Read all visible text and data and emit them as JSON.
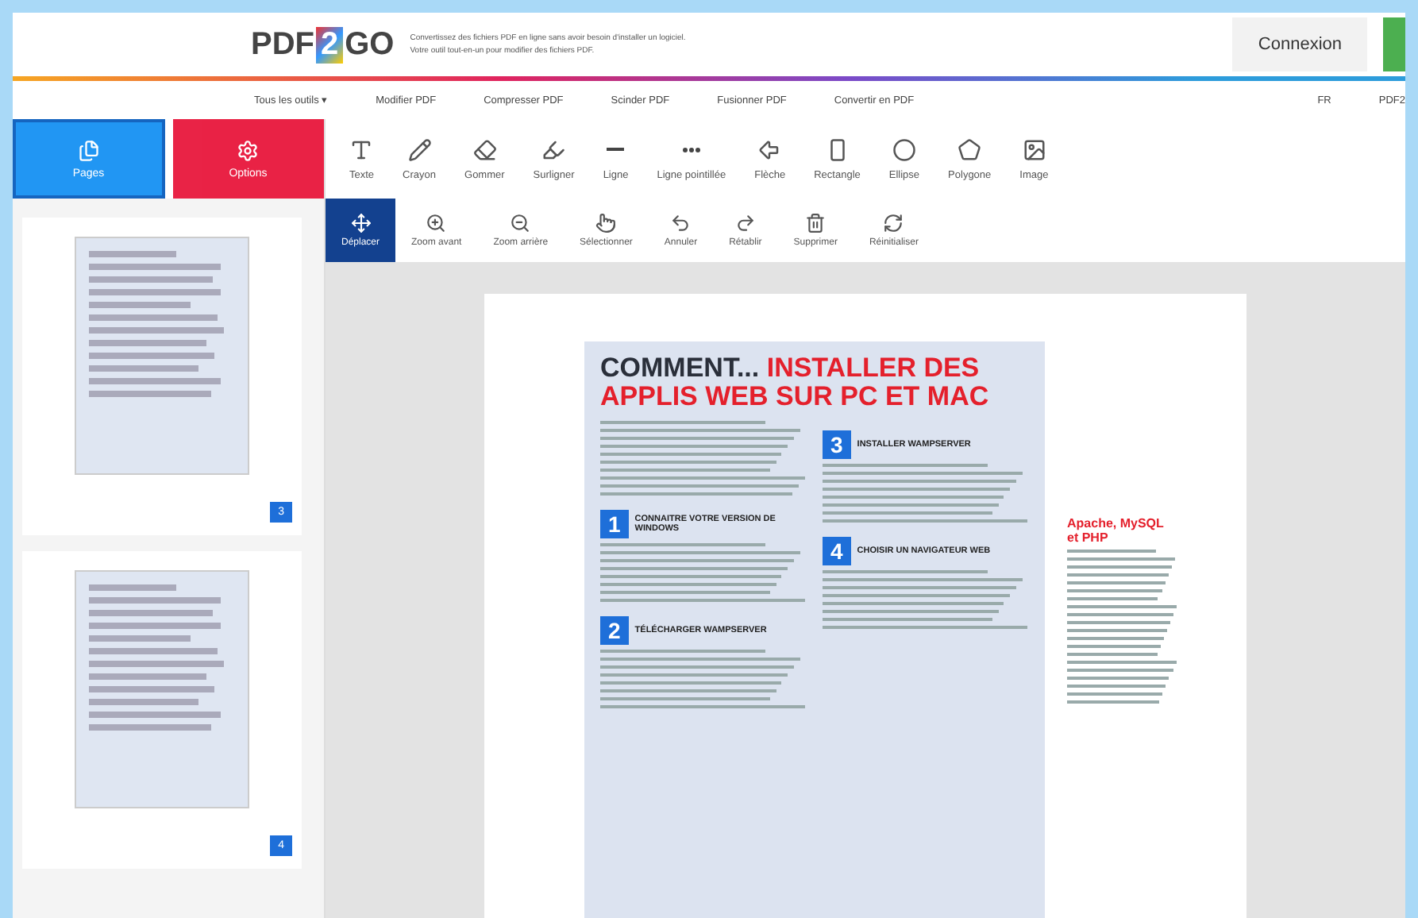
{
  "header": {
    "logo": {
      "left": "PDF",
      "middle": "2",
      "right": "GO"
    },
    "tagline": [
      "Convertissez des fichiers PDF en ligne sans avoir besoin d'installer un logiciel.",
      "Votre outil tout-en-un pour modifier des fichiers PDF."
    ],
    "login": "Connexion"
  },
  "nav": {
    "items": [
      "Tous les outils ▾",
      "Modifier PDF",
      "Compresser PDF",
      "Scinder PDF",
      "Fusionner PDF",
      "Convertir en PDF"
    ],
    "language": "FR",
    "brand": "PDF2"
  },
  "side_tabs": [
    {
      "label": "Pages",
      "selected": true
    },
    {
      "label": "Options",
      "selected": false
    }
  ],
  "tools": [
    {
      "label": "Texte"
    },
    {
      "label": "Crayon"
    },
    {
      "label": "Gommer"
    },
    {
      "label": "Surligner"
    },
    {
      "label": "Ligne"
    },
    {
      "label": "Ligne pointillée"
    },
    {
      "label": "Flèche"
    },
    {
      "label": "Rectangle"
    },
    {
      "label": "Ellipse"
    },
    {
      "label": "Polygone"
    },
    {
      "label": "Image"
    }
  ],
  "actions": [
    {
      "label": "Déplacer",
      "selected": true
    },
    {
      "label": "Zoom avant",
      "selected": false
    },
    {
      "label": "Zoom arrière",
      "selected": false
    },
    {
      "label": "Sélectionner",
      "selected": false
    },
    {
      "label": "Annuler",
      "selected": false
    },
    {
      "label": "Rétablir",
      "selected": false
    },
    {
      "label": "Supprimer",
      "selected": false
    },
    {
      "label": "Réinitialiser",
      "selected": false
    }
  ],
  "thumbnails": [
    {
      "page": "3"
    },
    {
      "page": "4"
    }
  ],
  "document": {
    "title_lead": "COMMENT...",
    "title_main": "INSTALLER DES APPLIS WEB SUR PC ET MAC",
    "steps": [
      {
        "number": "1",
        "heading": "CONNAITRE VOTRE VERSION DE WINDOWS"
      },
      {
        "number": "2",
        "heading": "TÉLÉCHARGER WAMPSERVER"
      },
      {
        "number": "3",
        "heading": "INSTALLER WAMPSERVER"
      },
      {
        "number": "4",
        "heading": "CHOISIR UN NAVIGATEUR WEB"
      }
    ],
    "sidebar_title": "Apache, MySQL et PHP"
  }
}
